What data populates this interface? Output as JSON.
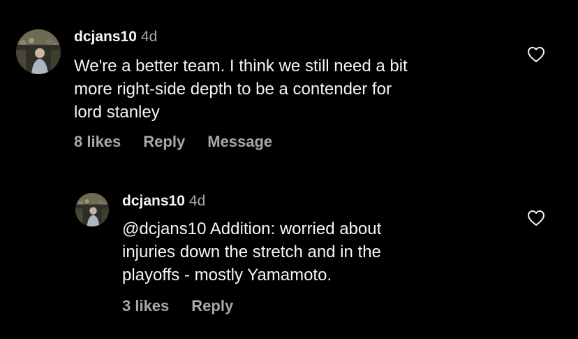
{
  "comments": [
    {
      "username": "dcjans10",
      "time": "4d",
      "text_lines": [
        "We're a better team. I think we still need a bit",
        "more right-side depth to be a contender for",
        "lord stanley"
      ],
      "likes": "8 likes",
      "reply": "Reply",
      "message": "Message"
    },
    {
      "username": "dcjans10",
      "time": "4d",
      "text_lines": [
        "@dcjans10 Addition: worried about",
        "injuries down the stretch and in the",
        "playoffs - mostly Yamamoto."
      ],
      "likes": "3 likes",
      "reply": "Reply"
    }
  ],
  "icons": {
    "like": "heart-outline-icon",
    "avatar": "profile-photo"
  },
  "colors": {
    "background": "#000000",
    "primary_text": "#f5f5f5",
    "secondary_text": "#a8a8a8"
  }
}
